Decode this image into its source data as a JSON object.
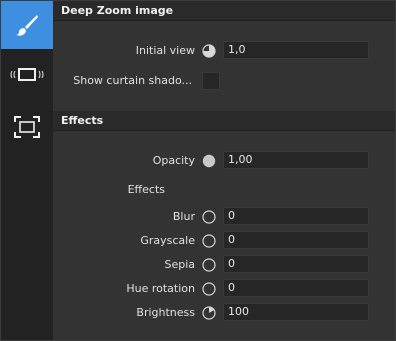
{
  "rail": {
    "items": [
      {
        "icon": "brush-icon",
        "active": true
      },
      {
        "icon": "curtain-icon",
        "active": false
      },
      {
        "icon": "frame-icon",
        "active": false
      }
    ]
  },
  "deep_zoom": {
    "title": "Deep Zoom image",
    "initial_view": {
      "label": "Initial view",
      "value": "1,0",
      "icon": "pie-icon"
    },
    "curtain_shadow": {
      "label": "Show curtain shado...",
      "checked": false
    }
  },
  "effects": {
    "title": "Effects",
    "opacity": {
      "label": "Opacity",
      "value": "1,00",
      "icon": "filled-circle-icon"
    },
    "subheading": "Effects",
    "items": [
      {
        "label": "Blur",
        "value": "0",
        "icon": "circle-icon"
      },
      {
        "label": "Grayscale",
        "value": "0",
        "icon": "circle-icon"
      },
      {
        "label": "Sepia",
        "value": "0",
        "icon": "circle-icon"
      },
      {
        "label": "Hue rotation",
        "value": "0",
        "icon": "circle-icon"
      },
      {
        "label": "Brightness",
        "value": "100",
        "icon": "dial-icon"
      }
    ]
  },
  "colors": {
    "accent": "#3f8fe0",
    "panel": "#333333",
    "header": "#2a2a2a",
    "rail": "#222222"
  }
}
